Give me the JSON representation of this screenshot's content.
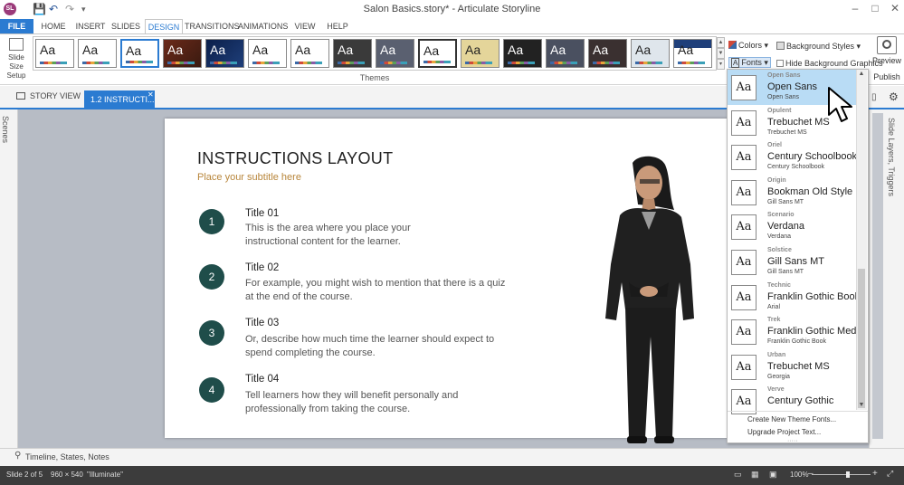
{
  "window": {
    "app_icon": "SL",
    "title": "Salon Basics.story* - Articulate Storyline",
    "controls": [
      "–",
      "□",
      "✕"
    ]
  },
  "ribbon_tabs": [
    "FILE",
    "HOME",
    "INSERT",
    "SLIDES",
    "DESIGN",
    "TRANSITIONS",
    "ANIMATIONS",
    "VIEW",
    "HELP"
  ],
  "ribbon": {
    "slide_size": [
      "Slide",
      "Size",
      "Setup"
    ],
    "themes_label": "Themes",
    "theme_thumb_text": "Aa",
    "colors_label": "Colors",
    "fonts_label": "Fonts",
    "background_styles_label": "Background Styles",
    "hide_background_label": "Hide Background Graphics",
    "preview_label": "Preview",
    "publish_label": "Publish"
  },
  "doc_tabs": {
    "story_view": "STORY VIEW",
    "active": "1.2 INSTRUCTI..."
  },
  "side_panels": {
    "scenes": "Scenes",
    "right": "Slide Layers, Triggers",
    "timeline": "Timeline, States, Notes"
  },
  "slide": {
    "title": "INSTRUCTIONS LAYOUT",
    "subtitle": "Place your subtitle here",
    "items": [
      {
        "num": "1",
        "title": "Title 01",
        "line1": "This is the area where you place your",
        "line2": "instructional content for the learner."
      },
      {
        "num": "2",
        "title": "Title 02",
        "line1": "For example, you might wish to mention that there is a quiz",
        "line2": "at the end of the course."
      },
      {
        "num": "3",
        "title": "Title 03",
        "line1": "Or, describe how much time the learner should expect to",
        "line2": "spend completing the course."
      },
      {
        "num": "4",
        "title": "Title 04",
        "line1": "Tell learners how they will benefit personally and",
        "line2": "professionally from taking the course."
      }
    ]
  },
  "font_menu": {
    "thumb_text": "Aa",
    "items": [
      {
        "category": "Open Sans",
        "heading": "Open Sans",
        "body": "Open Sans",
        "selected": true
      },
      {
        "category": "Opulent",
        "heading": "Trebuchet MS",
        "body": "Trebuchet MS"
      },
      {
        "category": "Oriel",
        "heading": "Century Schoolbook",
        "body": "Century Schoolbook"
      },
      {
        "category": "Origin",
        "heading": "Bookman Old Style",
        "body": "Gill Sans MT"
      },
      {
        "category": "Scenario",
        "heading": "Verdana",
        "body": "Verdana"
      },
      {
        "category": "Solstice",
        "heading": "Gill Sans MT",
        "body": "Gill Sans MT"
      },
      {
        "category": "Technic",
        "heading": "Franklin Gothic Book",
        "body": "Arial"
      },
      {
        "category": "Trek",
        "heading": "Franklin Gothic Medi...",
        "body": "Franklin Gothic Book"
      },
      {
        "category": "Urban",
        "heading": "Trebuchet MS",
        "body": "Georgia"
      },
      {
        "category": "Verve",
        "heading": "Century Gothic",
        "body": ""
      }
    ],
    "create_new": "Create New Theme Fonts...",
    "upgrade": "Upgrade Project Text..."
  },
  "status": {
    "slide": "Slide 2 of 5",
    "size": "960 × 540",
    "theme": "\"Illuminate\"",
    "zoom": "100%"
  },
  "colors": {
    "accent": "#2b7bd1",
    "circle": "#1f4d4a",
    "subtitle": "#b8863b"
  }
}
